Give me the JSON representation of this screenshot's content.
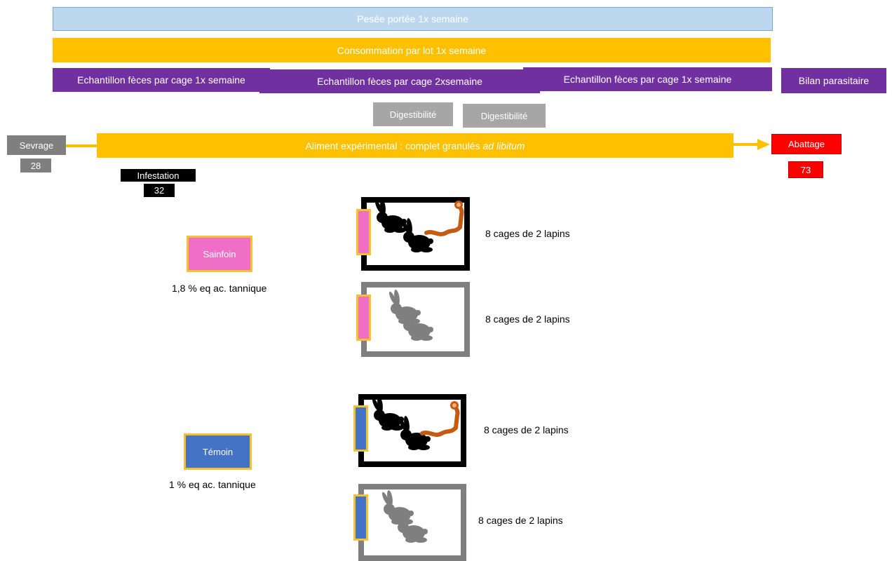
{
  "timeline": {
    "pesee": "Pesée portée 1x semaine",
    "consommation": "Consommation par lot 1x semaine",
    "echantillon_1": "Echantillon fèces par cage 1x semaine",
    "echantillon_2": "Echantillon fèces par cage 2xsemaine",
    "echantillon_3": "Echantillon fèces par cage 1x semaine",
    "bilan": "Bilan parasitaire",
    "digestibilite_1": "Digestibilité",
    "digestibilite_2": "Digestibilité",
    "aliment_prefix": "Aliment expérimental : complet granulés ",
    "aliment_italic": "ad libitum",
    "sevrage": "Sevrage",
    "sevrage_day": "28",
    "infestation": "Infestation",
    "infestation_day": "32",
    "abattage": "Abattage",
    "abattage_day": "73"
  },
  "groups": [
    {
      "name": "Sainfoin",
      "tannin": "1,8 % eq ac. tannique",
      "color": "#f06fc6",
      "cages": [
        {
          "label": "8 cages de 2 lapins",
          "infested": true
        },
        {
          "label": "8 cages de 2 lapins",
          "infested": false
        }
      ]
    },
    {
      "name": "Témoin",
      "tannin": "1 % eq ac. tannique",
      "color": "#4472c4",
      "cages": [
        {
          "label": "8 cages de 2 lapins",
          "infested": true
        },
        {
          "label": "8 cages de 2 lapins",
          "infested": false
        }
      ]
    }
  ],
  "colors": {
    "pesee_bg": "#bdd7ee",
    "orange": "#ffc000",
    "purple": "#7030a0",
    "gray": "#a6a6a6",
    "red": "#ff0000",
    "black": "#000000",
    "worm": "#c55a11"
  }
}
